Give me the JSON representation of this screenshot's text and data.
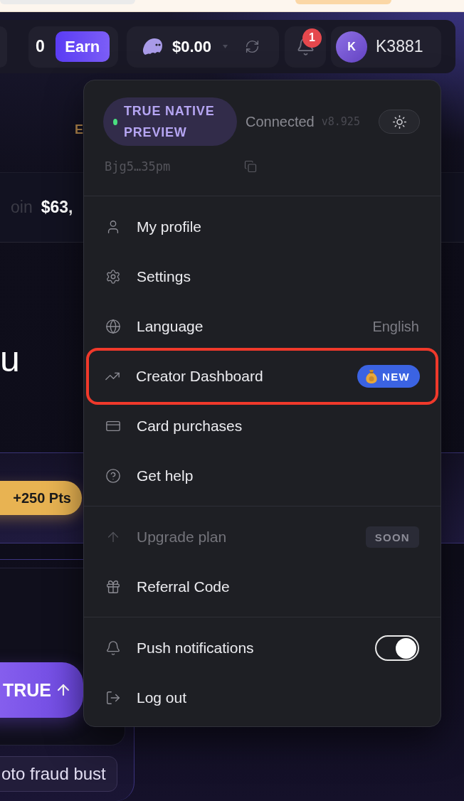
{
  "header": {
    "points": "0",
    "earn_button": "Earn",
    "balance": "$0.00",
    "notification_count": "1",
    "avatar_initial": "K",
    "username": "K3881"
  },
  "page": {
    "tab_label": "E",
    "price_label": "oin",
    "price_value": "$63,",
    "heading": "u",
    "points_badge": "+250 Pts",
    "action_button": "TRUE",
    "topic_chip": "oto fraud bust"
  },
  "menu": {
    "preview": {
      "label": "TRUE NATIVE PREVIEW",
      "online": true
    },
    "status": "Connected",
    "version": "v8.925",
    "address": "Bjg5…35pm",
    "sections": [
      {
        "items": [
          {
            "kind": "plain",
            "label": "My profile",
            "disabled": false,
            "highlighted": false
          },
          {
            "kind": "plain",
            "label": "Settings",
            "disabled": false,
            "highlighted": false
          },
          {
            "kind": "value",
            "label": "Language",
            "value": "English",
            "disabled": false,
            "highlighted": false
          },
          {
            "kind": "badge",
            "label": "Creator Dashboard",
            "badge": {
              "kind": "accent",
              "text": "NEW"
            },
            "disabled": false,
            "highlighted": true
          },
          {
            "kind": "plain",
            "label": "Card purchases",
            "disabled": false,
            "highlighted": false
          },
          {
            "kind": "plain",
            "label": "Get help",
            "disabled": false,
            "highlighted": false
          }
        ]
      },
      {
        "items": [
          {
            "kind": "badge",
            "label": "Upgrade plan",
            "badge": {
              "kind": "muted",
              "text": "SOON"
            },
            "disabled": true,
            "highlighted": false
          },
          {
            "kind": "plain",
            "label": "Referral Code",
            "disabled": false,
            "highlighted": false
          }
        ]
      },
      {
        "items": [
          {
            "kind": "toggle",
            "label": "Push notifications",
            "on": true,
            "disabled": false,
            "highlighted": false
          },
          {
            "kind": "plain",
            "label": "Log out",
            "disabled": false,
            "highlighted": false
          }
        ]
      }
    ]
  }
}
